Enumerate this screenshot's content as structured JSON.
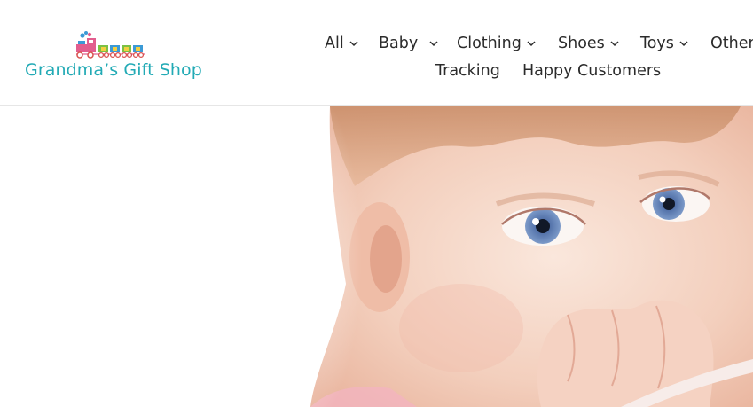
{
  "brand": {
    "name": "Grandma’s Gift Shop",
    "colors": {
      "teal": "#22aab5",
      "pink": "#e25d8e",
      "green": "#7cc144",
      "blue": "#3b9ad6",
      "red": "#d9534f"
    }
  },
  "nav": {
    "items": [
      {
        "label": "All",
        "has_dropdown": true
      },
      {
        "label": "Baby",
        "has_dropdown": true
      },
      {
        "label": "Clothing",
        "has_dropdown": true
      },
      {
        "label": "Shoes",
        "has_dropdown": true
      },
      {
        "label": "Toys",
        "has_dropdown": true
      },
      {
        "label": "Other",
        "has_dropdown": false
      },
      {
        "label": "Tracking",
        "has_dropdown": false
      },
      {
        "label": "Happy Customers",
        "has_dropdown": false
      }
    ],
    "dropdown_icon": "chevron-down-icon"
  },
  "hero": {
    "image": "baby-portrait",
    "icon_names": [
      "baby-face-photo"
    ]
  }
}
